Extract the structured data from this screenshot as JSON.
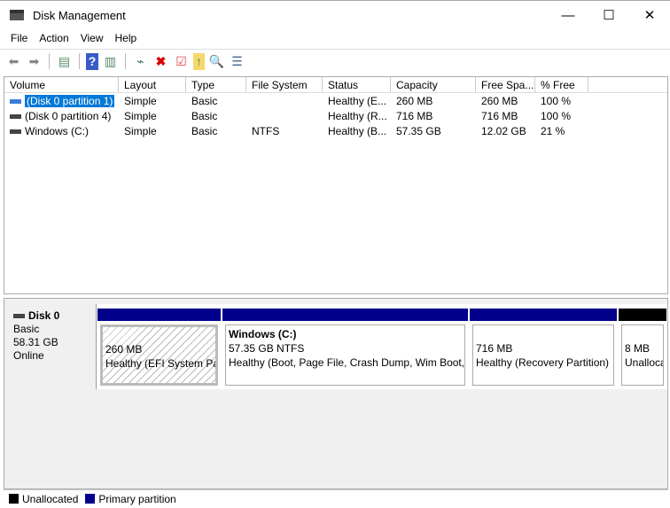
{
  "window": {
    "title": "Disk Management",
    "minimize": "—",
    "maximize": "☐",
    "close": "✕"
  },
  "menu": [
    "File",
    "Action",
    "View",
    "Help"
  ],
  "columns": [
    "Volume",
    "Layout",
    "Type",
    "File System",
    "Status",
    "Capacity",
    "Free Spa...",
    "% Free"
  ],
  "volumes": [
    [
      "(Disk 0 partition 1)",
      "Simple",
      "Basic",
      "",
      "Healthy (E...",
      "260 MB",
      "260 MB",
      "100 %"
    ],
    [
      "(Disk 0 partition 4)",
      "Simple",
      "Basic",
      "",
      "Healthy (R...",
      "716 MB",
      "716 MB",
      "100 %"
    ],
    [
      "Windows (C:)",
      "Simple",
      "Basic",
      "NTFS",
      "Healthy (B...",
      "57.35 GB",
      "12.02 GB",
      "21 %"
    ]
  ],
  "disk": {
    "name": "Disk 0",
    "type": "Basic",
    "size": "58.31 GB",
    "status": "Online"
  },
  "partitions": [
    {
      "name": "",
      "size": "260 MB",
      "status": "Healthy (EFI System Partition)"
    },
    {
      "name": "Windows  (C:)",
      "size": "57.35 GB NTFS",
      "status": "Healthy (Boot, Page File, Crash Dump, Wim Boot, Basic Data Partition)"
    },
    {
      "name": "",
      "size": "716 MB",
      "status": "Healthy (Recovery Partition)"
    },
    {
      "name": "",
      "size": "8 MB",
      "status": "Unallocated"
    }
  ],
  "legend": {
    "unallocated": "Unallocated",
    "primary": "Primary partition"
  },
  "colors": {
    "primary": "#00008b",
    "unallocated": "#000000",
    "selection": "#0078d7"
  }
}
